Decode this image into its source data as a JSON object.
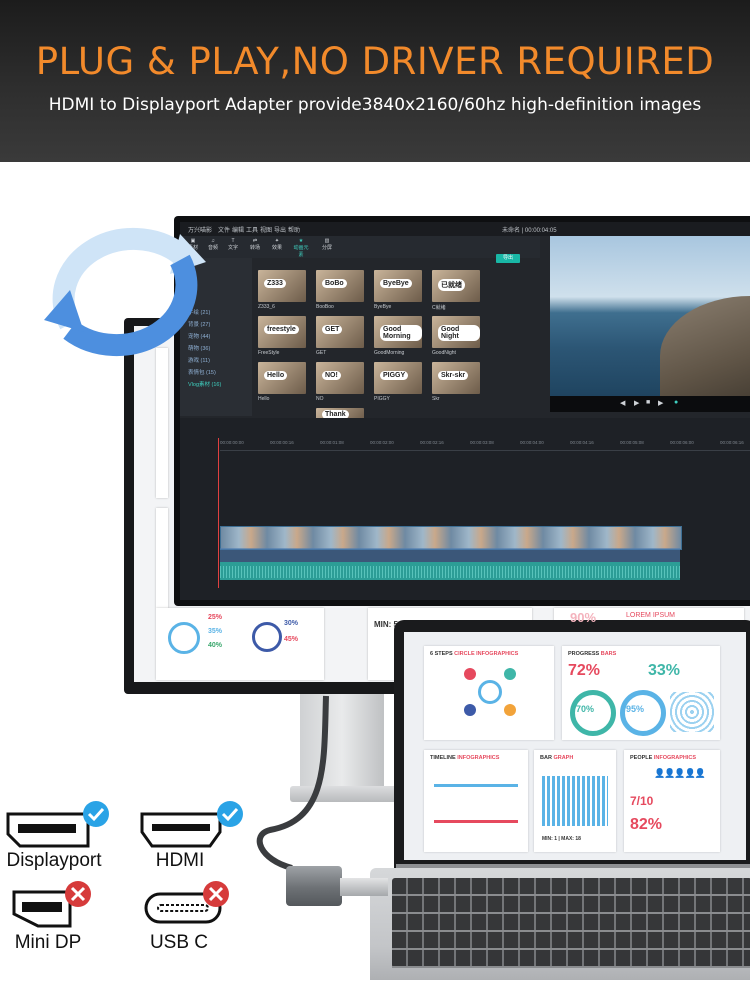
{
  "banner": {
    "title": "PLUG & PLAY,NO DRIVER REQUIRED",
    "subtitle": "HDMI to Displayport Adapter provide3840x2160/60hz high-definition images"
  },
  "editor": {
    "menu": [
      "万兴喵影",
      "文件",
      "编辑",
      "工具",
      "视图",
      "导出",
      "帮助"
    ],
    "timecode": "未命名 | 00:00:04:05",
    "export_label": "导出",
    "tools": [
      "素材",
      "音频",
      "文字",
      "转场",
      "效果",
      "动画元素",
      "分屏"
    ],
    "sidebar": [
      "手绘 (21)",
      "背景 (27)",
      "宠物 (44)",
      "萌物 (36)",
      "游戏 (11)",
      "表情包 (15)",
      "Vlog素材 (16)"
    ],
    "stickers": [
      {
        "text": "Z333",
        "label": "Z333_6"
      },
      {
        "text": "BoBo",
        "label": "BooBoo"
      },
      {
        "text": "ByeBye",
        "label": "ByeBye"
      },
      {
        "text": "已就绪",
        "label": "C就绪"
      },
      {
        "text": "freestyle",
        "label": "FreeStyle"
      },
      {
        "text": "GET",
        "label": "GET"
      },
      {
        "text": "Good Morning",
        "label": "GoodMorning"
      },
      {
        "text": "Good Night",
        "label": "GoodNight"
      },
      {
        "text": "Hello",
        "label": "Hello"
      },
      {
        "text": "NO!",
        "label": "NO"
      },
      {
        "text": "PIGGY",
        "label": "PIGGY"
      },
      {
        "text": "Skr-skr",
        "label": "Skr"
      },
      {
        "text": "",
        "label": ""
      },
      {
        "text": "Thank",
        "label": ""
      },
      {
        "text": "",
        "label": ""
      },
      {
        "text": "",
        "label": ""
      }
    ],
    "ruler": [
      "00:00:00:00",
      "00:00:00:16",
      "00:00:01:08",
      "00:00:02:00",
      "00:00:02:16",
      "00:00:03:08",
      "00:00:04:00",
      "00:00:04:16",
      "00:00:05:08",
      "00:00:06:00",
      "00:00:06:16"
    ]
  },
  "back_monitor": {
    "pcts": [
      "25%",
      "35%",
      "40%",
      "30%",
      "45%"
    ],
    "min_text": "MIN: 5"
  },
  "laptop": {
    "cards": {
      "steps_title": "6 STEPS",
      "steps_title_accent": "CIRCLE INFOGRAPHICS",
      "progress_title": "PROGRESS",
      "progress_title_accent": "BARS",
      "progress_pct_a": "72%",
      "progress_pct_b": "33%",
      "progress_circle_a": "70%",
      "progress_circle_b": "95%",
      "timeline_title": "TIMELINE",
      "timeline_title_accent": "INFOGRAPHICS",
      "bar_title": "BAR",
      "bar_title_accent": "GRAPH",
      "bar_min_max": "MIN: 1 | MAX: 18",
      "people_title": "PEOPLE",
      "people_title_accent": "INFOGRAPHICS",
      "people_fraction": "7/10",
      "people_pct": "82%",
      "back_pct": "90%",
      "back_label": "LOREM IPSUM"
    }
  },
  "ports": [
    {
      "label": "Displayport",
      "supported": true,
      "icon": "displayport-port-icon"
    },
    {
      "label": "HDMI",
      "supported": true,
      "icon": "hdmi-port-icon"
    },
    {
      "label": "Mini DP",
      "supported": false,
      "icon": "mini-dp-port-icon"
    },
    {
      "label": "USB C",
      "supported": false,
      "icon": "usb-c-port-icon"
    }
  ],
  "colors": {
    "title": "#f28a2b",
    "check": "#2aa3e6",
    "cross": "#d63b3b",
    "accent": "#e6495e"
  }
}
